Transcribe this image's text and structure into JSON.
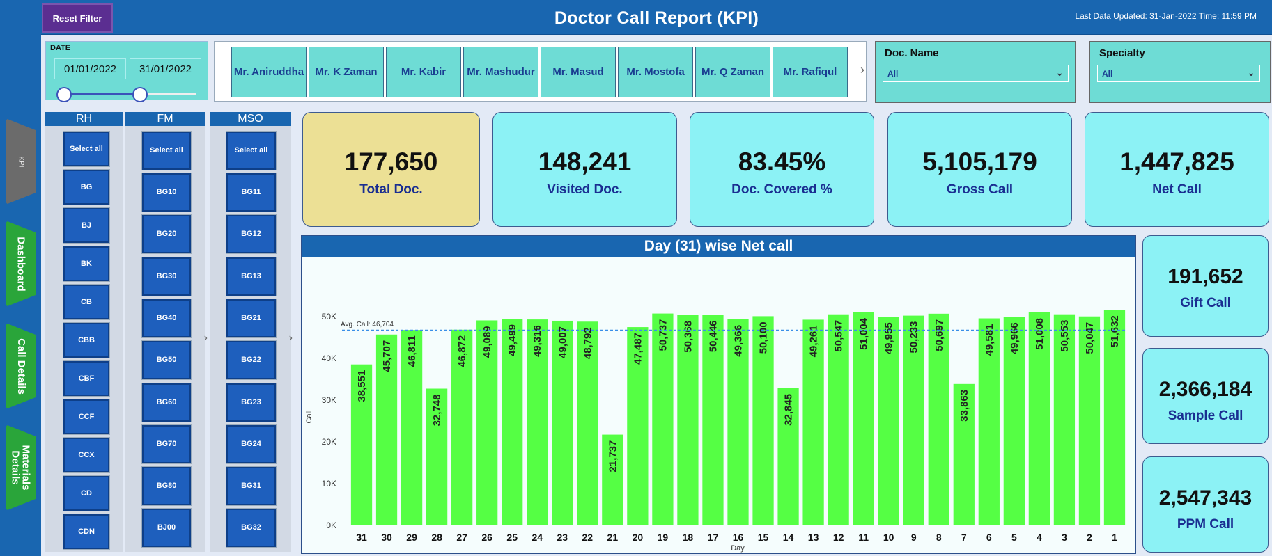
{
  "header": {
    "reset_label": "Reset Filter",
    "title": "Doctor Call Report (KPI)",
    "last_updated": "Last Data Updated: 31-Jan-2022 Time: 11:59 PM"
  },
  "nav": {
    "tabs": [
      "KPI",
      "Dashboard",
      "Call Details",
      "Materials Details"
    ]
  },
  "date_slicer": {
    "label": "DATE",
    "start": "01/01/2022",
    "end": "31/01/2022"
  },
  "person_slicer": {
    "people": [
      "Mr. Aniruddha",
      "Mr. K Zaman",
      "Mr. Kabir",
      "Mr. Mashudur",
      "Mr. Masud",
      "Mr. Mostofa",
      "Mr. Q Zaman",
      "Mr. Rafiqul"
    ],
    "next_icon": "chevron-right-icon"
  },
  "doc_name": {
    "title": "Doc. Name",
    "value": "All"
  },
  "specialty": {
    "title": "Specialty",
    "value": "All"
  },
  "rh": {
    "title": "RH",
    "items": [
      "Select all",
      "BG",
      "BJ",
      "BK",
      "CB",
      "CBB",
      "CBF",
      "CCF",
      "CCX",
      "CD",
      "CDN"
    ]
  },
  "fm": {
    "title": "FM",
    "items": [
      "Select all",
      "BG10",
      "BG20",
      "BG30",
      "BG40",
      "BG50",
      "BG60",
      "BG70",
      "BG80",
      "BJ00"
    ]
  },
  "mso": {
    "title": "MSO",
    "items": [
      "Select all",
      "BG11",
      "BG12",
      "BG13",
      "BG21",
      "BG22",
      "BG23",
      "BG24",
      "BG31",
      "BG32"
    ]
  },
  "kpis": {
    "total_doc": {
      "value": "177,650",
      "label": "Total Doc."
    },
    "visited_doc": {
      "value": "148,241",
      "label": "Visited Doc."
    },
    "covered": {
      "value": "83.45%",
      "label": "Doc. Covered %"
    },
    "gross_call": {
      "value": "5,105,179",
      "label": "Gross Call"
    },
    "net_call": {
      "value": "1,447,825",
      "label": "Net Call"
    },
    "gift_call": {
      "value": "191,652",
      "label": "Gift Call"
    },
    "sample_call": {
      "value": "2,366,184",
      "label": "Sample Call"
    },
    "ppm_call": {
      "value": "2,547,343",
      "label": "PPM Call"
    }
  },
  "colors": {
    "bar": "#55ff44",
    "avg_line": "#3a8fe8",
    "header_blue": "#1966b0",
    "kpi_total_bg": "#ece095",
    "kpi_bg": "#8cf2f5"
  },
  "chart_data": {
    "type": "bar",
    "title": "Day (31) wise Net call",
    "xlabel": "Day",
    "ylabel": "Call",
    "categories": [
      "31",
      "30",
      "29",
      "28",
      "27",
      "26",
      "25",
      "24",
      "23",
      "22",
      "21",
      "20",
      "19",
      "18",
      "17",
      "16",
      "15",
      "14",
      "13",
      "12",
      "11",
      "10",
      "9",
      "8",
      "7",
      "6",
      "5",
      "4",
      "3",
      "2",
      "1"
    ],
    "values": [
      38551,
      45707,
      46811,
      32748,
      46872,
      49089,
      49499,
      49316,
      49007,
      48792,
      21737,
      47487,
      50737,
      50368,
      50446,
      49366,
      50100,
      32845,
      49261,
      50547,
      51004,
      49955,
      50233,
      50697,
      33863,
      49581,
      49966,
      51008,
      50553,
      50047,
      51632
    ],
    "data_labels": [
      "38,551",
      "45,707",
      "46,811",
      "32,748",
      "46,872",
      "49,089",
      "49,499",
      "49,316",
      "49,007",
      "48,792",
      "21,737",
      "47,487",
      "50,737",
      "50,368",
      "50,446",
      "49,366",
      "50,100",
      "32,845",
      "49,261",
      "50,547",
      "51,004",
      "49,955",
      "50,233",
      "50,697",
      "33,863",
      "49,581",
      "49,966",
      "51,008",
      "50,553",
      "50,047",
      "51,632"
    ],
    "yticks": [
      "0K",
      "10K",
      "20K",
      "30K",
      "40K",
      "50K"
    ],
    "ylim": [
      0,
      50000
    ],
    "avg_label": "Avg. Call: 46,704",
    "avg_value": 46704,
    "grid": false
  }
}
